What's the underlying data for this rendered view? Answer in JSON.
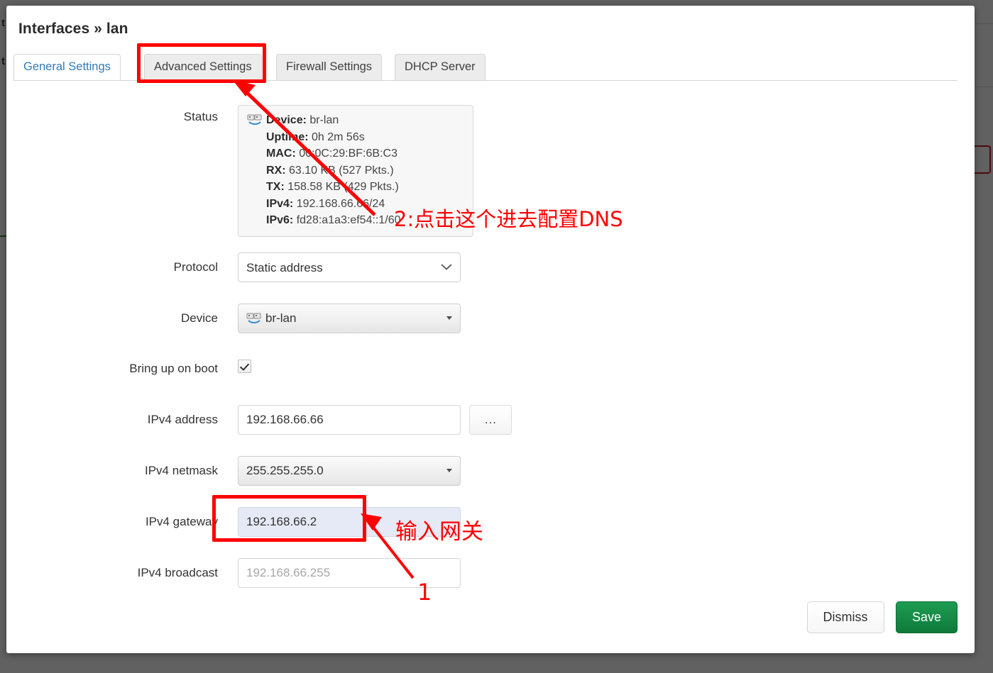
{
  "dialog": {
    "title": "Interfaces » lan",
    "tabs": [
      {
        "label": "General Settings",
        "active": true
      },
      {
        "label": "Advanced Settings",
        "active": false
      },
      {
        "label": "Firewall Settings",
        "active": false
      },
      {
        "label": "DHCP Server",
        "active": false
      }
    ],
    "footer": {
      "dismiss_label": "Dismiss",
      "save_label": "Save"
    }
  },
  "form": {
    "status": {
      "label": "Status",
      "icon": "network-bridge-icon",
      "lines": [
        {
          "key": "Device:",
          "value": "br-lan"
        },
        {
          "key": "Uptime:",
          "value": "0h 2m 56s"
        },
        {
          "key": "MAC:",
          "value": "00:0C:29:BF:6B:C3"
        },
        {
          "key": "RX:",
          "value": "63.10 KB (527 Pkts.)"
        },
        {
          "key": "TX:",
          "value": "158.58 KB (429 Pkts.)"
        },
        {
          "key": "IPv4:",
          "value": "192.168.66.66/24"
        },
        {
          "key": "IPv6:",
          "value": "fd28:a1a3:ef54::1/60"
        }
      ]
    },
    "protocol": {
      "label": "Protocol",
      "value": "Static address"
    },
    "device": {
      "label": "Device",
      "value": "br-lan",
      "icon": "network-bridge-icon"
    },
    "bring_up_on_boot": {
      "label": "Bring up on boot",
      "checked": true
    },
    "ipv4_address": {
      "label": "IPv4 address",
      "value": "192.168.66.66",
      "more_button_label": "..."
    },
    "ipv4_netmask": {
      "label": "IPv4 netmask",
      "value": "255.255.255.0"
    },
    "ipv4_gateway": {
      "label": "IPv4 gateway",
      "value": "192.168.66.2"
    },
    "ipv4_broadcast": {
      "label": "IPv4 broadcast",
      "value": "",
      "placeholder": "192.168.66.255"
    }
  },
  "annotations": {
    "color": "#fe0000",
    "step1_number": "1",
    "step1_text": "输入网关",
    "step2_text": "2:点击这个进去配置DNS"
  }
}
